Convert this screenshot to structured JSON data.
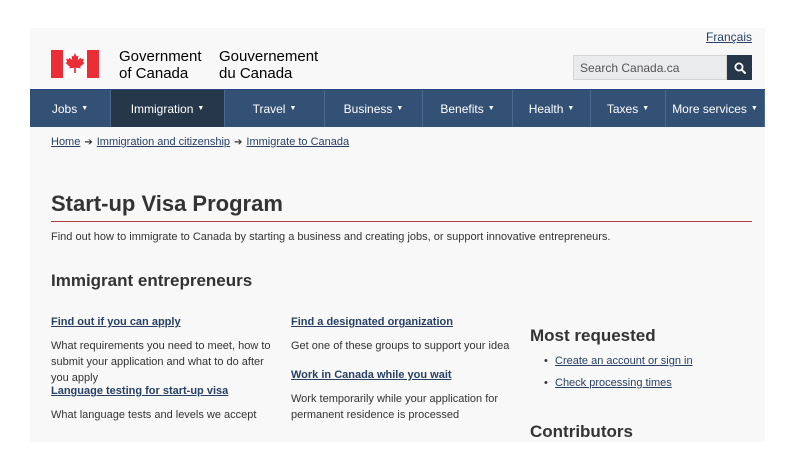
{
  "header": {
    "language_toggle": "Français",
    "brand_en_line1": "Government",
    "brand_en_line2": "of Canada",
    "brand_fr_line1": "Gouvernement",
    "brand_fr_line2": "du Canada",
    "search_placeholder": "Search Canada.ca"
  },
  "nav": {
    "items": [
      {
        "label": "Jobs"
      },
      {
        "label": "Immigration"
      },
      {
        "label": "Travel"
      },
      {
        "label": "Business"
      },
      {
        "label": "Benefits"
      },
      {
        "label": "Health"
      },
      {
        "label": "Taxes"
      },
      {
        "label": "More services"
      }
    ],
    "active": "Immigration"
  },
  "breadcrumb": {
    "items": [
      "Home",
      "Immigration and citizenship",
      "Immigrate to Canada"
    ]
  },
  "main": {
    "title": "Start-up Visa Program",
    "lead": "Find out how to immigrate to Canada by starting a business and creating jobs, or support innovative entrepreneurs.",
    "section_title": "Immigrant entrepreneurs",
    "items": [
      {
        "link": "Find out if you can apply",
        "desc": "What requirements you need to meet, how to submit your application and what to do after you apply"
      },
      {
        "link": "Find a designated organization",
        "desc": "Get one of these groups to support your idea"
      },
      {
        "link": "Language testing for start-up visa",
        "desc": "What language tests and levels we accept"
      },
      {
        "link": "Work in Canada while you wait",
        "desc": "Work temporarily while your application for permanent residence is processed"
      }
    ]
  },
  "sidebar": {
    "most_requested_title": "Most requested",
    "links": [
      "Create an account or sign in",
      "Check processing times"
    ],
    "contributors_title": "Contributors"
  },
  "colors": {
    "nav_bg": "#335075",
    "nav_active": "#26374a",
    "link": "#284162",
    "flag_red": "#eb2d37",
    "title_rule": "#af3c43"
  }
}
